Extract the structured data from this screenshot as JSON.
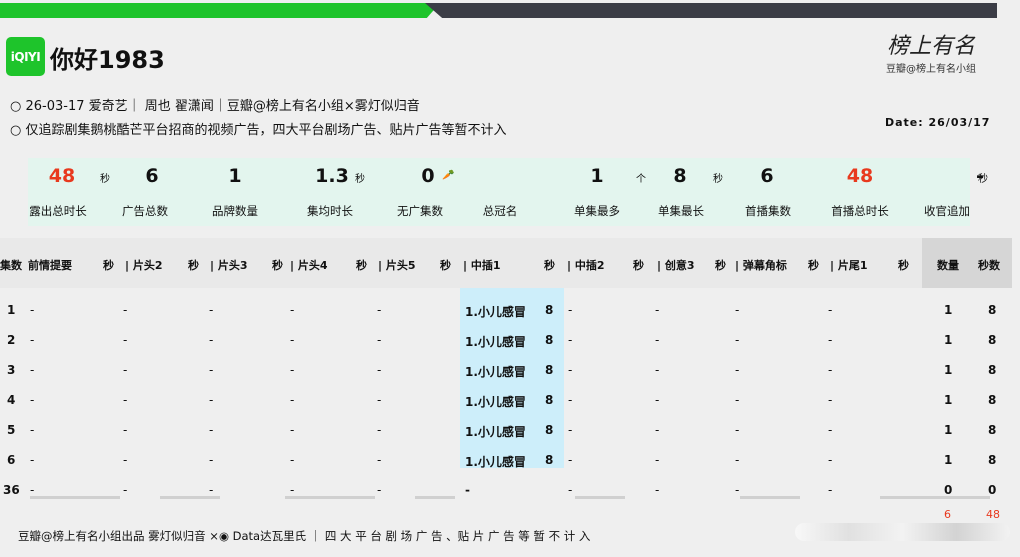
{
  "header": {
    "logo_text": "iQIYI",
    "title": "你好1983",
    "meta_line1": "26-03-17 爱奇艺｜ 周也 翟潇闻｜豆瓣@榜上有名小组×雾灯似归音",
    "meta_line2": "仅追踪剧集鹅桃酷芒平台招商的视频广告，四大平台剧场广告、贴片广告等暂不计入",
    "brand_signature": "榜上有名",
    "brand_sub": "豆瓣@榜上有名小组",
    "date": "Date: 26/03/17"
  },
  "summary": [
    {
      "value": "48",
      "unit": "秒",
      "label": "露出总时长",
      "red": true
    },
    {
      "value": "6",
      "unit": "",
      "label": "广告总数"
    },
    {
      "value": "1",
      "unit": "",
      "label": "品牌数量"
    },
    {
      "value": "1.3",
      "unit": "秒",
      "label": "集均时长"
    },
    {
      "value": "0",
      "unit": "🥕",
      "label": "无广集数"
    },
    {
      "value": "",
      "unit": "",
      "label": "总冠名"
    },
    {
      "value": "1",
      "unit": "个",
      "label": "单集最多"
    },
    {
      "value": "8",
      "unit": "秒",
      "label": "单集最长"
    },
    {
      "value": "6",
      "unit": "",
      "label": "首播集数"
    },
    {
      "value": "48",
      "unit": "",
      "label": "首播总时长",
      "red": true
    },
    {
      "value": "-",
      "unit": "秒",
      "label": "收官追加"
    }
  ],
  "columns": [
    "集数",
    "前情提要",
    "秒",
    "| 片头2",
    "秒",
    "| 片头3",
    "秒",
    "| 片头4",
    "秒",
    "| 片头5",
    "秒",
    "| 中插1",
    "秒",
    "| 中插2",
    "秒",
    "| 创意3",
    "秒",
    "| 弹幕角标",
    "秒",
    "| 片尾1",
    "秒",
    "数量",
    "秒数"
  ],
  "rows": [
    {
      "ep": "1",
      "mid1": "1.小儿感冒",
      "mid1_sec": "8",
      "count": "1",
      "secs": "8"
    },
    {
      "ep": "2",
      "mid1": "1.小儿感冒",
      "mid1_sec": "8",
      "count": "1",
      "secs": "8"
    },
    {
      "ep": "3",
      "mid1": "1.小儿感冒",
      "mid1_sec": "8",
      "count": "1",
      "secs": "8"
    },
    {
      "ep": "4",
      "mid1": "1.小儿感冒",
      "mid1_sec": "8",
      "count": "1",
      "secs": "8"
    },
    {
      "ep": "5",
      "mid1": "1.小儿感冒",
      "mid1_sec": "8",
      "count": "1",
      "secs": "8"
    },
    {
      "ep": "6",
      "mid1": "1.小儿感冒",
      "mid1_sec": "8",
      "count": "1",
      "secs": "8"
    },
    {
      "ep": "36",
      "mid1": "-",
      "mid1_sec": "",
      "count": "0",
      "secs": "0"
    }
  ],
  "empty": "-",
  "totals": {
    "count": "6",
    "secs": "48"
  },
  "footer": "豆瓣@榜上有名小组出品  雾灯似归音 ×◉ Data达瓦里氏 ｜ 四 大 平 台 剧 场 广 告 、贴 片 广 告 等 暂 不 计 入",
  "colors": {
    "green": "#1ec42b",
    "red": "#e8391e",
    "mint": "#e3f5ee",
    "cyan": "#cdeefa"
  }
}
